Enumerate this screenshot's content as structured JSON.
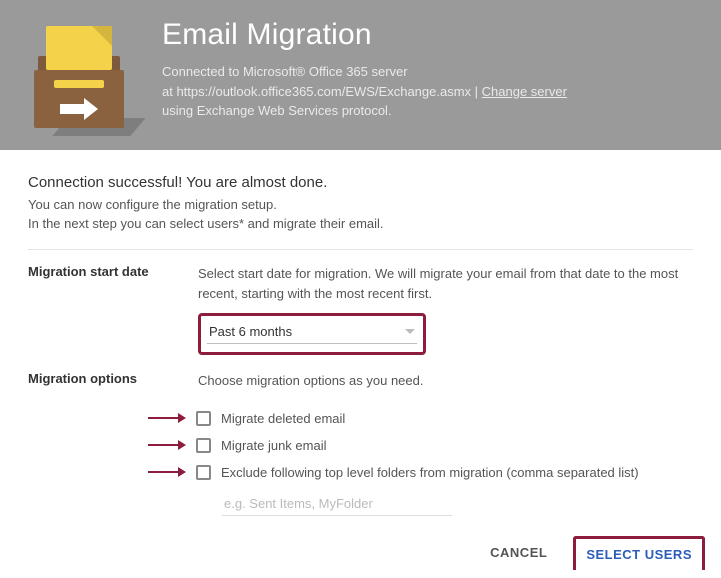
{
  "header": {
    "title": "Email Migration",
    "connected_line1": "Connected to Microsoft® Office 365 server",
    "connected_line2_prefix": "at https://outlook.office365.com/EWS/Exchange.asmx | ",
    "change_server": "Change server",
    "protocol_line": "using Exchange Web Services protocol."
  },
  "intro": {
    "title": "Connection successful! You are almost done.",
    "line1": "You can now configure the migration setup.",
    "line2": "In the next step you can select users* and migrate their email."
  },
  "start_date": {
    "label": "Migration start date",
    "desc": "Select start date for migration. We will migrate your email from that date to the most recent, starting with the most recent first.",
    "selected": "Past 6 months"
  },
  "options": {
    "label": "Migration options",
    "desc": "Choose migration options as you need.",
    "opt1": "Migrate deleted email",
    "opt2": "Migrate junk email",
    "opt3": "Exclude following top level folders from migration (comma separated list)",
    "exclude_placeholder": "e.g. Sent Items, MyFolder"
  },
  "footer": {
    "cancel": "CANCEL",
    "select_users": "SELECT USERS"
  }
}
